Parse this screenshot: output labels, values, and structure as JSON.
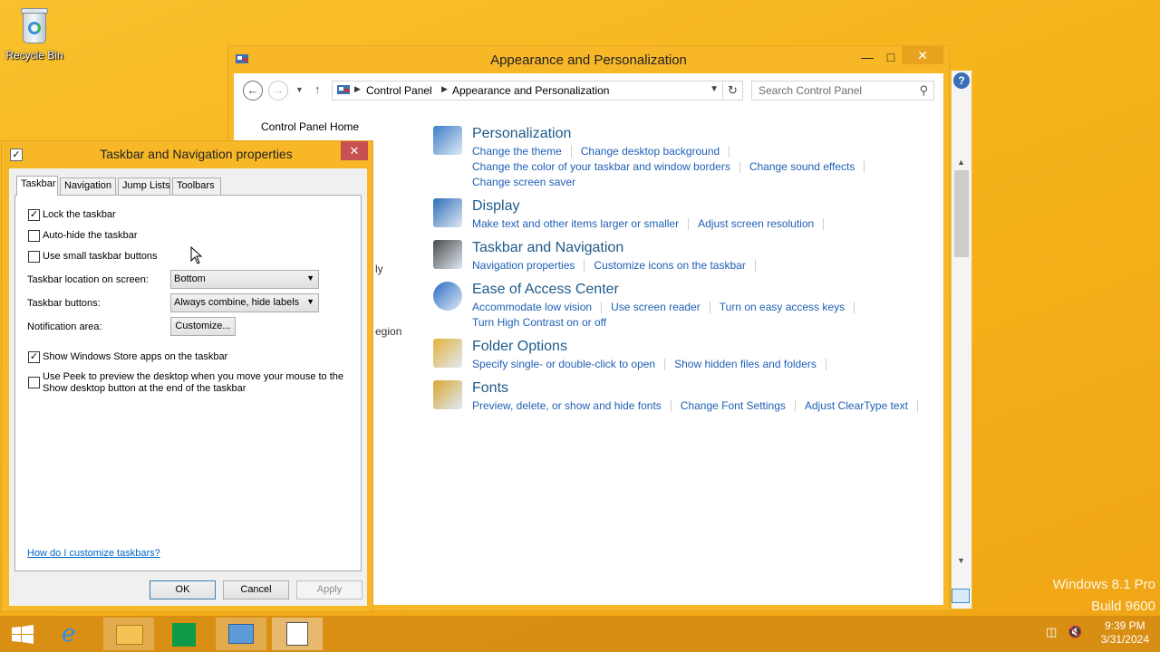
{
  "desktop": {
    "recycle_bin_label": "Recycle Bin",
    "watermark_line1": "Windows 8.1 Pro",
    "watermark_line2": "Build 9600"
  },
  "control_panel": {
    "title": "Appearance and Personalization",
    "breadcrumb": [
      "Control Panel",
      "Appearance and Personalization"
    ],
    "search_placeholder": "Search Control Panel",
    "sidebar_home": "Control Panel Home",
    "sidebar_fragments": [
      "ly",
      "egion"
    ],
    "categories": [
      {
        "title": "Personalization",
        "icon": "personalization-icon",
        "lines": [
          [
            "Change the theme",
            "Change desktop background"
          ],
          [
            "Change the color of your taskbar and window borders",
            "Change sound effects"
          ],
          [
            "Change screen saver"
          ]
        ]
      },
      {
        "title": "Display",
        "icon": "display-icon",
        "lines": [
          [
            "Make text and other items larger or smaller",
            "Adjust screen resolution"
          ]
        ]
      },
      {
        "title": "Taskbar and Navigation",
        "icon": "taskbar-icon",
        "lines": [
          [
            "Navigation properties",
            "Customize icons on the taskbar"
          ]
        ]
      },
      {
        "title": "Ease of Access Center",
        "icon": "ease-of-access-icon",
        "lines": [
          [
            "Accommodate low vision",
            "Use screen reader",
            "Turn on easy access keys"
          ],
          [
            "Turn High Contrast on or off"
          ]
        ]
      },
      {
        "title": "Folder Options",
        "icon": "folder-icon",
        "lines": [
          [
            "Specify single- or double-click to open",
            "Show hidden files and folders"
          ]
        ]
      },
      {
        "title": "Fonts",
        "icon": "fonts-icon",
        "lines": [
          [
            "Preview, delete, or show and hide fonts",
            "Change Font Settings",
            "Adjust ClearType text"
          ]
        ]
      }
    ]
  },
  "dialog": {
    "title": "Taskbar and Navigation properties",
    "tabs": [
      "Taskbar",
      "Navigation",
      "Jump Lists",
      "Toolbars"
    ],
    "active_tab": "Taskbar",
    "lock_taskbar": {
      "label": "Lock the taskbar",
      "checked": true
    },
    "auto_hide": {
      "label": "Auto-hide the taskbar",
      "checked": false
    },
    "small_buttons": {
      "label": "Use small taskbar buttons",
      "checked": false
    },
    "location_label": "Taskbar location on screen:",
    "location_value": "Bottom",
    "buttons_label": "Taskbar buttons:",
    "buttons_value": "Always combine, hide labels",
    "notification_label": "Notification area:",
    "customize_button": "Customize...",
    "store_apps": {
      "label": "Show Windows Store apps on the taskbar",
      "checked": true
    },
    "peek_line1": "Use Peek to preview the desktop when you move your mouse to the",
    "peek_line2": "Show desktop button at the end of the taskbar",
    "peek_checked": false,
    "help_link": "How do I customize taskbars?",
    "ok": "OK",
    "cancel": "Cancel",
    "apply": "Apply"
  },
  "taskbar": {
    "clock_time": "9:39 PM",
    "clock_date": "3/31/2024",
    "pinned": [
      "start-button",
      "internet-explorer",
      "file-explorer",
      "windows-store",
      "control-panel",
      "taskbar-properties"
    ]
  },
  "colors": {
    "accent": "#f7b727",
    "link": "#1f5fb5",
    "category_title": "#1e5a8a"
  }
}
